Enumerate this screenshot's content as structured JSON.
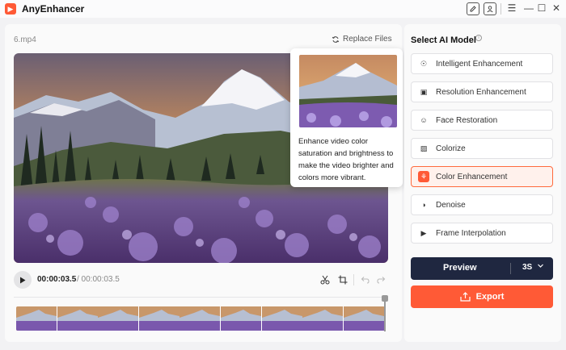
{
  "app": {
    "title": "AnyEnhancer",
    "logo_glyph": "▶"
  },
  "titlebar": {
    "icons": [
      "edit-icon",
      "account-icon",
      "menu-icon",
      "minimize-icon",
      "maximize-icon",
      "close-icon"
    ],
    "menu_glyph": "☰",
    "minimize_glyph": "—",
    "maximize_glyph": "☐",
    "close_glyph": "✕"
  },
  "editor": {
    "file_name": "6.mp4",
    "replace_label": "Replace Files",
    "time_current": "00:00:03.5",
    "time_total": "/ 00:00:03.5"
  },
  "tooltip": {
    "text": "Enhance video color saturation and brightness to make the video brighter and colors more vibrant."
  },
  "models": {
    "heading": "Select AI Model",
    "info_glyph": "i",
    "items": [
      {
        "label": "Intelligent Enhancement",
        "icon": "robot-icon",
        "glyph": "☉",
        "selected": false
      },
      {
        "label": "Resolution Enhancement",
        "icon": "resolution-icon",
        "glyph": "▣",
        "selected": false
      },
      {
        "label": "Face Restoration",
        "icon": "face-icon",
        "glyph": "☺",
        "selected": false
      },
      {
        "label": "Colorize",
        "icon": "colorize-icon",
        "glyph": "▨",
        "selected": false
      },
      {
        "label": "Color Enhancement",
        "icon": "color-enhance-icon",
        "glyph": "⚘",
        "selected": true
      },
      {
        "label": "Denoise",
        "icon": "denoise-icon",
        "glyph": "◑",
        "selected": false
      },
      {
        "label": "Frame Interpolation",
        "icon": "frame-interp-icon",
        "glyph": "▶",
        "selected": false
      }
    ]
  },
  "actions": {
    "preview_label": "Preview",
    "preview_duration": "3S",
    "export_label": "Export"
  },
  "colors": {
    "accent": "#ff5a36",
    "preview_bg": "#1f2740",
    "selected_bg": "#fff1ec"
  }
}
